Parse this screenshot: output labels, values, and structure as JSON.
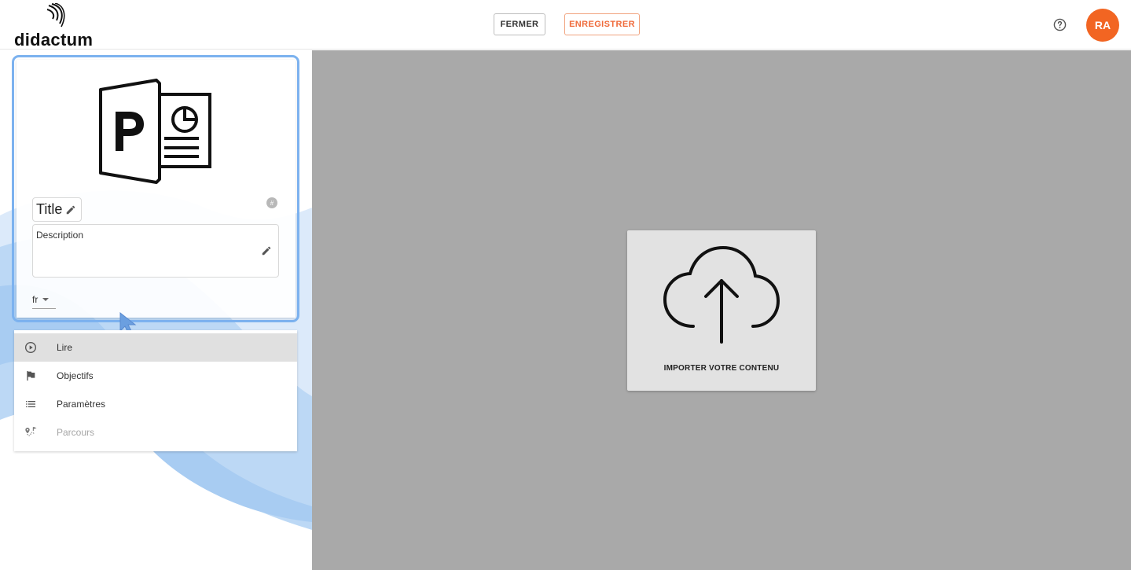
{
  "brand": {
    "name": "didactum"
  },
  "header": {
    "close_label": "FERMER",
    "save_label": "ENREGISTRER",
    "help_icon": "help-circle-icon",
    "avatar_initials": "RA",
    "avatar_color": "#f26522",
    "save_color": "#ef6a3a"
  },
  "card": {
    "type_icon": "powerpoint-icon",
    "title": "Title",
    "description_label": "Description",
    "language": "fr",
    "focus_color": "#7cb2ef"
  },
  "menu": {
    "items": [
      {
        "label": "Lire",
        "icon": "play-circle-icon",
        "active": true,
        "disabled": false
      },
      {
        "label": "Objectifs",
        "icon": "flag-icon",
        "active": false,
        "disabled": false
      },
      {
        "label": "Paramètres",
        "icon": "list-icon",
        "active": false,
        "disabled": false
      },
      {
        "label": "Parcours",
        "icon": "route-icon",
        "active": false,
        "disabled": true
      }
    ]
  },
  "main": {
    "upload_label": "IMPORTER VOTRE CONTENU",
    "upload_icon": "cloud-upload-icon",
    "background_color": "#a9a9a9"
  }
}
